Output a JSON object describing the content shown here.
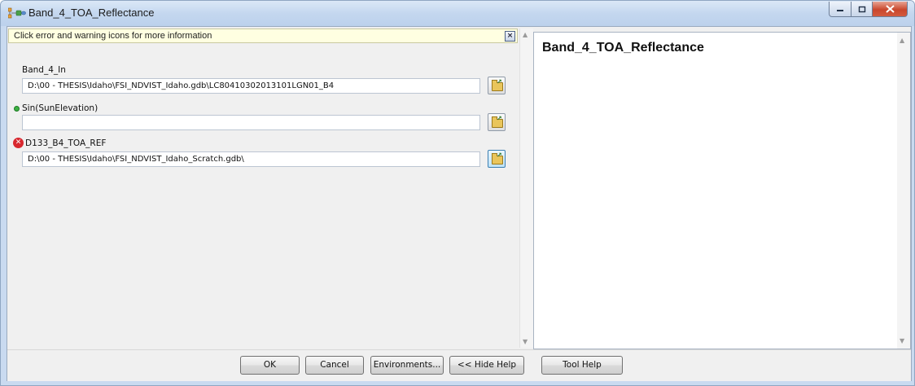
{
  "window": {
    "title": "Band_4_TOA_Reflectance",
    "minimize_icon": "minimize-icon",
    "maximize_icon": "maximize-icon",
    "close_icon": "close-icon"
  },
  "message_bar": {
    "text": "Click error and warning icons for more information",
    "close_glyph": "×"
  },
  "parameters": [
    {
      "label": "Band_4_In",
      "value": "D:\\00 - THESIS\\Idaho\\FSI_NDVIST_Idaho.gdb\\LC80410302013101LGN01_B4",
      "status": "none"
    },
    {
      "label": "Sin(SunElevation)",
      "value": "",
      "status": "optional"
    },
    {
      "label": "D133_B4_TOA_REF",
      "value": "D:\\00 - THESIS\\Idaho\\FSI_NDVIST_Idaho_Scratch.gdb\\",
      "status": "error"
    }
  ],
  "error_glyph": "✕",
  "help": {
    "title": "Band_4_TOA_Reflectance"
  },
  "buttons": {
    "ok": "OK",
    "cancel": "Cancel",
    "environments": "Environments...",
    "hide_help": "<< Hide Help",
    "tool_help": "Tool Help"
  },
  "colors": {
    "message_bar_bg": "#ffffe1",
    "error_red": "#d8282f",
    "optional_green": "#3cb043",
    "close_red": "#c9472d"
  }
}
